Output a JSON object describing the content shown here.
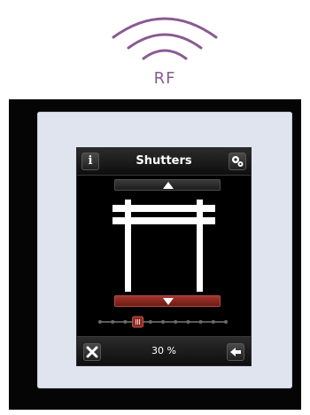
{
  "rf_badge": {
    "label": "RF",
    "color": "#8a5a93"
  },
  "screen": {
    "title": "Shutters",
    "info_label": "i",
    "percent_label": "30 %",
    "position_percent": 30,
    "accent_down": "#8e2a22"
  },
  "icons": {
    "info": "info-icon",
    "settings": "gears-icon",
    "up": "arrow-up-icon",
    "down": "arrow-down-icon",
    "close": "close-icon",
    "back": "arrow-left-icon"
  }
}
